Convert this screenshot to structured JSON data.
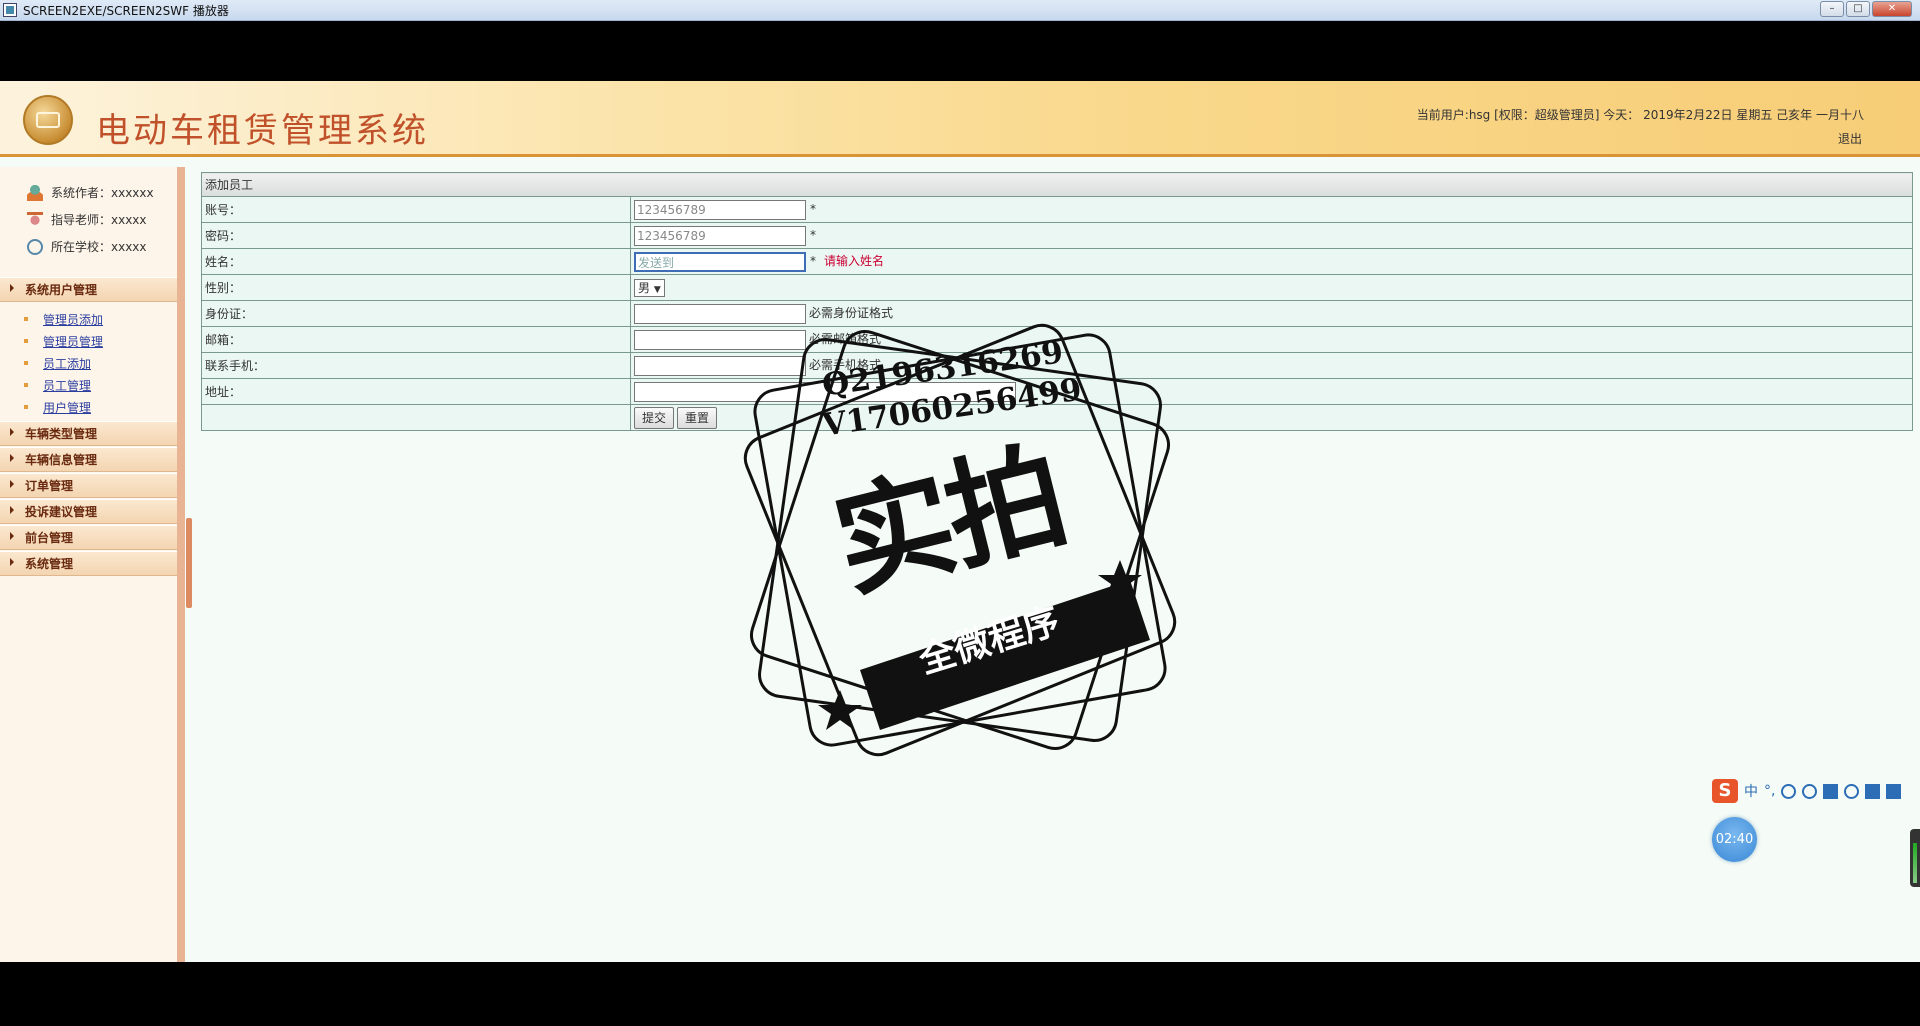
{
  "window": {
    "title": "SCREEN2EXE/SCREEN2SWF 播放器",
    "minimize": "–",
    "maximize": "□",
    "close": "✕"
  },
  "header": {
    "title": "电动车租赁管理系统",
    "user_info": "当前用户:hsg [权限：超级管理员] 今天： 2019年2月22日 星期五 己亥年 一月十八",
    "logout": "退出"
  },
  "sidebar": {
    "info": [
      {
        "label": "系统作者：xxxxxx",
        "icon": "person-icon"
      },
      {
        "label": "指导老师：xxxxx",
        "icon": "teacher-icon"
      },
      {
        "label": "所在学校：xxxxx",
        "icon": "school-icon"
      }
    ],
    "groups": [
      {
        "label": "系统用户管理"
      },
      {
        "label": "车辆类型管理"
      },
      {
        "label": "车辆信息管理"
      },
      {
        "label": "订单管理"
      },
      {
        "label": "投诉建议管理"
      },
      {
        "label": "前台管理"
      },
      {
        "label": "系统管理"
      }
    ],
    "submenu": [
      {
        "label": "管理员添加"
      },
      {
        "label": "管理员管理"
      },
      {
        "label": "员工添加"
      },
      {
        "label": "员工管理"
      },
      {
        "label": "用户管理"
      }
    ]
  },
  "form": {
    "title": "添加员工",
    "account_label": "账号：",
    "account_value": "123456789",
    "password_label": "密码：",
    "password_value": "123456789",
    "name_label": "姓名：",
    "name_value": "发送到",
    "name_error": "请输入姓名",
    "gender_label": "性别：",
    "gender_value": "男",
    "gender_arrow": "▼",
    "idcard_label": "身份证：",
    "idcard_hint": "必需身份证格式",
    "email_label": "邮箱：",
    "email_hint": "必需邮箱格式",
    "phone_label": "联系手机：",
    "phone_hint": "必需手机格式",
    "address_label": "地址：",
    "required_mark": "*",
    "submit": "提交",
    "reset": "重置"
  },
  "watermark": {
    "line1": "Q2196316269",
    "line2": "V17060256499",
    "big": "实拍",
    "banner": "全微程序"
  },
  "ime": {
    "logo": "S",
    "mode": "中",
    "punct": "°,"
  },
  "timer": "02:40"
}
